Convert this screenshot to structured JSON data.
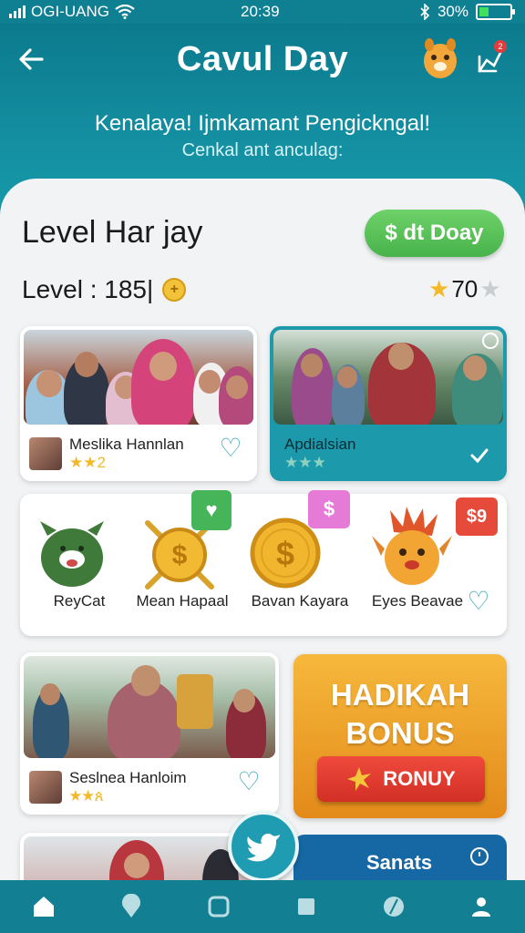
{
  "status_bar": {
    "carrier": "OGI-UANG",
    "time": "20:39",
    "battery": "30%",
    "battery_level": 0.3
  },
  "header": {
    "title": "Cavul Day",
    "subtitle": "Kenalaya! Ijmkamant Pengickngal!",
    "subtitle2": "Cenkal ant anculag:",
    "notification_count": "2"
  },
  "level": {
    "title": "Level Har jay",
    "action_button": "$ dt Doay",
    "label": "Level : 185|",
    "coin_symbol": "+",
    "star_count": "70"
  },
  "cards": [
    {
      "name": "Meslika Hannlan",
      "rating": "★★2"
    },
    {
      "name": "Apdialsian",
      "rating": "★★★"
    },
    {
      "name": "Seslnea Hanloim",
      "rating": "★★ጰ"
    }
  ],
  "items": [
    {
      "label": "ReyCat",
      "icon": "green-cat-icon"
    },
    {
      "label": "Mean Hapaal",
      "icon": "dollar-coin-icon",
      "badge": "heart"
    },
    {
      "label": "Bavan Kayara",
      "icon": "gold-coin-icon",
      "badge": "$"
    },
    {
      "label": "Eyes Beavae",
      "icon": "turkey-mascot-icon",
      "badge": "$9"
    }
  ],
  "bonus": {
    "title_line1": "HADIKAH",
    "title_line2": "BONUS",
    "button": "RONUY"
  },
  "sanats": {
    "label": "Sanats"
  },
  "nav": [
    "home-icon",
    "location-icon",
    "square-icon",
    "box-icon",
    "leaf-icon",
    "profile-icon"
  ],
  "colors": {
    "primary": "#0f7f92",
    "accent_green": "#47b34a",
    "accent_orange": "#e38a1a",
    "accent_red": "#d22f26",
    "star": "#f4b92a"
  }
}
